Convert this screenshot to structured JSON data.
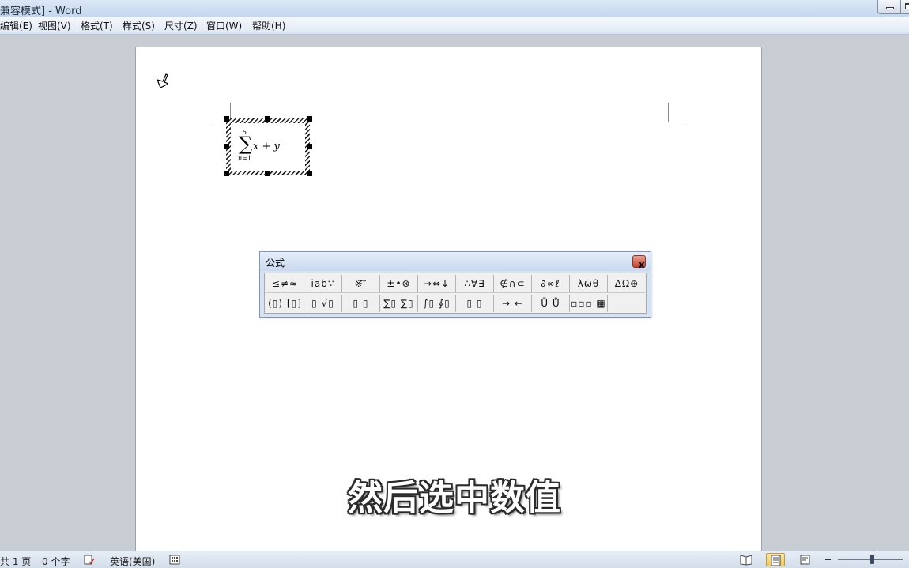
{
  "window": {
    "title": "兼容模式] - Word"
  },
  "menu": {
    "items": [
      {
        "label": "编辑(E)"
      },
      {
        "label": "视图(V)"
      },
      {
        "label": "格式(T)"
      },
      {
        "label": "样式(S)"
      },
      {
        "label": "尺寸(Z)"
      },
      {
        "label": "窗口(W)"
      },
      {
        "label": "帮助(H)"
      }
    ]
  },
  "equation": {
    "upper_limit": "5",
    "operator": "∑",
    "lower_var": "n",
    "lower_rest": "=1",
    "var1": "x",
    "plus": " + ",
    "var2": "y"
  },
  "palette": {
    "title": "公式",
    "close_glyph": "x",
    "row1": [
      {
        "label": "≤≠≈"
      },
      {
        "label": "ⅰab∵"
      },
      {
        "label": "※⃗ ⃗"
      },
      {
        "label": "±•⊗"
      },
      {
        "label": "→⇔↓"
      },
      {
        "label": "∴∀∃"
      },
      {
        "label": "∉∩⊂"
      },
      {
        "label": "∂∞ℓ"
      },
      {
        "label": "λωθ"
      },
      {
        "label": "ΔΩ⊛"
      }
    ],
    "row2": [
      {
        "label": "(▯) [▯]"
      },
      {
        "label": "▯ √▯"
      },
      {
        "label": "▯ ▯"
      },
      {
        "label": "∑▯ ∑▯"
      },
      {
        "label": "∫▯ ∮▯"
      },
      {
        "label": "▯ ▯"
      },
      {
        "label": "→ ←"
      },
      {
        "label": "Ū Ů"
      },
      {
        "label": "▫▫▫ ▦"
      }
    ]
  },
  "subtitle": "然后选中数值",
  "statusbar": {
    "page": "共 1 页",
    "words": "0 个字",
    "language": "英语(美国)"
  }
}
